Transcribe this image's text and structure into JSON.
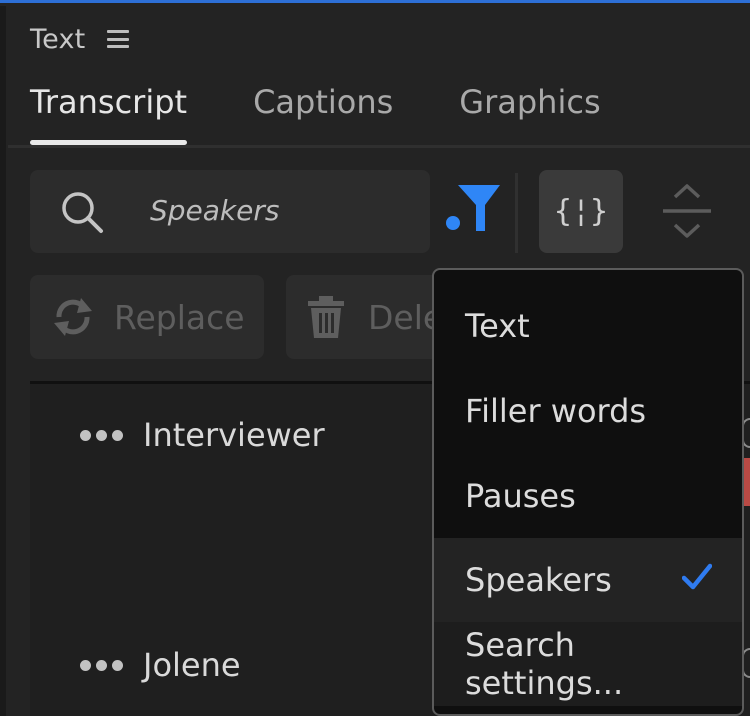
{
  "panel": {
    "title": "Text"
  },
  "tabs": [
    {
      "label": "Transcript",
      "active": true
    },
    {
      "label": "Captions",
      "active": false
    },
    {
      "label": "Graphics",
      "active": false
    }
  ],
  "search": {
    "value": "Speakers"
  },
  "toolbar": {
    "code_glyph": "{¦}"
  },
  "actions": {
    "replace_label": "Replace",
    "delete_label": "Delete"
  },
  "speakers": [
    {
      "name": "Interviewer"
    },
    {
      "name": "Jolene"
    }
  ],
  "filter_menu": {
    "items": [
      {
        "label": "Text",
        "checked": false
      },
      {
        "label": "Filler words",
        "checked": false
      },
      {
        "label": "Pauses",
        "checked": false
      },
      {
        "label": "Speakers",
        "checked": true
      },
      {
        "label": "Search settings..."
      }
    ]
  },
  "colors": {
    "accent": "#2d6fd6",
    "check": "#2f7bf0",
    "filter_icon": "#2f86f6",
    "panel_bg": "#232323",
    "menu_bg": "#0f0f0f"
  }
}
